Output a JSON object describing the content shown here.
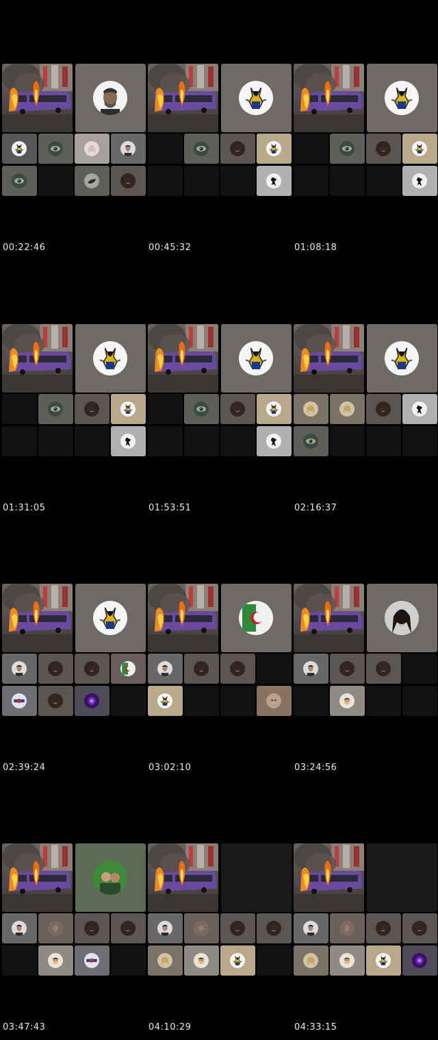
{
  "thumbnails": [
    {
      "timestamp": "00:22:46",
      "main_avatar": "bearded-man",
      "row1": [
        "wolverine",
        "eye",
        "woman-light",
        "man"
      ],
      "row2": [
        "eye",
        "empty",
        "bird",
        "woman"
      ]
    },
    {
      "timestamp": "00:45:32",
      "main_avatar": "wolverine",
      "row1": [
        "empty",
        "eye",
        "woman",
        "wolverine-small"
      ],
      "row2": [
        "empty",
        "empty",
        "empty",
        "black-figure"
      ]
    },
    {
      "timestamp": "01:08:18",
      "main_avatar": "wolverine",
      "row1": [
        "empty",
        "eye",
        "woman",
        "wolverine-small"
      ],
      "row2": [
        "empty",
        "empty",
        "empty",
        "black-figure"
      ]
    },
    {
      "timestamp": "01:31:05",
      "main_avatar": "wolverine",
      "row1": [
        "empty",
        "eye",
        "woman",
        "wolverine-small"
      ],
      "row2": [
        "empty",
        "empty",
        "empty",
        "black-figure"
      ]
    },
    {
      "timestamp": "01:53:51",
      "main_avatar": "wolverine",
      "row1": [
        "empty",
        "eye",
        "woman",
        "wolverine-small"
      ],
      "row2": [
        "empty",
        "empty",
        "empty",
        "black-figure"
      ]
    },
    {
      "timestamp": "02:16:37",
      "main_avatar": "wolverine",
      "row1": [
        "woman-blonde",
        "woman-blonde",
        "woman",
        "black-figure"
      ],
      "row2": [
        "eye",
        "empty",
        "empty",
        "empty"
      ]
    },
    {
      "timestamp": "02:39:24",
      "main_avatar": "wolverine",
      "row1": [
        "man",
        "woman",
        "woman",
        "flag"
      ],
      "row2": [
        "logo-blue",
        "woman",
        "purple",
        "empty"
      ]
    },
    {
      "timestamp": "03:02:10",
      "main_avatar": "flag-big",
      "row1": [
        "man",
        "woman",
        "woman",
        "empty"
      ],
      "row2": [
        "wolverine-small",
        "empty",
        "empty",
        "woman-glasses"
      ]
    },
    {
      "timestamp": "03:24:56",
      "main_avatar": "woman-dark",
      "row1": [
        "man",
        "woman",
        "woman",
        "empty"
      ],
      "row2": [
        "empty",
        "cartoon",
        "empty",
        "empty"
      ]
    },
    {
      "timestamp": "03:47:43",
      "main_avatar": "group-photo",
      "row1": [
        "man",
        "woman-blurred",
        "woman",
        "woman"
      ],
      "row2": [
        "empty",
        "cartoon",
        "logo-blue",
        "empty"
      ]
    },
    {
      "timestamp": "04:10:29",
      "main_avatar": "none",
      "row1": [
        "man",
        "woman-blurred",
        "woman",
        "woman"
      ],
      "row2": [
        "woman-blonde",
        "cartoon",
        "wolverine-small",
        "empty"
      ]
    },
    {
      "timestamp": "04:33:15",
      "main_avatar": "none",
      "row1": [
        "man",
        "woman-blurred",
        "woman",
        "woman"
      ],
      "row2": [
        "woman-blonde",
        "cartoon",
        "wolverine-small",
        "purple"
      ]
    }
  ]
}
